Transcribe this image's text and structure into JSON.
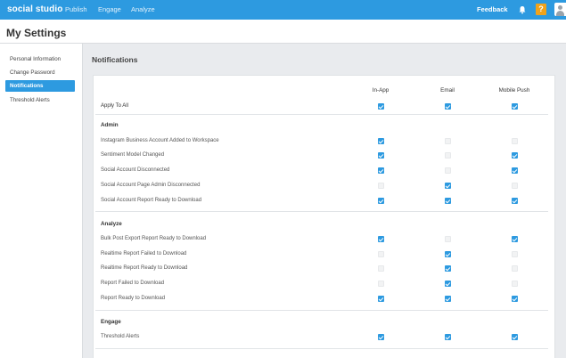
{
  "header": {
    "brand": "social studio",
    "nav": [
      "Publish",
      "Engage",
      "Analyze"
    ],
    "feedback": "Feedback",
    "help_label": "?",
    "icons": [
      "bell-icon",
      "help-icon",
      "avatar-icon"
    ],
    "accent_color": "#2d9ae0"
  },
  "page": {
    "title": "My Settings"
  },
  "sidebar": {
    "items": [
      {
        "label": "Personal Information",
        "active": false
      },
      {
        "label": "Change Password",
        "active": false
      },
      {
        "label": "Notifications",
        "active": true
      },
      {
        "label": "Threshold Alerts",
        "active": false
      }
    ]
  },
  "notifications": {
    "title": "Notifications",
    "columns": [
      "In-App",
      "Email",
      "Mobile Push"
    ],
    "apply_all": {
      "label": "Apply To All",
      "values": [
        true,
        true,
        true
      ]
    },
    "sections": [
      {
        "title": "Admin",
        "rows": [
          {
            "label": "Instagram Business Account Added to Workspace",
            "values": [
              true,
              false,
              false
            ]
          },
          {
            "label": "Sentiment Model Changed",
            "values": [
              true,
              false,
              true
            ]
          },
          {
            "label": "Social Account Disconnected",
            "values": [
              true,
              false,
              true
            ]
          },
          {
            "label": "Social Account Page Admin Disconnected",
            "values": [
              false,
              true,
              false
            ]
          },
          {
            "label": "Social Account Report Ready to Download",
            "values": [
              true,
              true,
              true
            ]
          }
        ]
      },
      {
        "title": "Analyze",
        "rows": [
          {
            "label": "Bulk Post Export Report Ready to Download",
            "values": [
              true,
              false,
              true
            ]
          },
          {
            "label": "Realtime Report Failed to Download",
            "values": [
              false,
              true,
              false
            ]
          },
          {
            "label": "Realtime Report Ready to Download",
            "values": [
              false,
              true,
              false
            ]
          },
          {
            "label": "Report Failed to Download",
            "values": [
              false,
              true,
              false
            ]
          },
          {
            "label": "Report Ready to Download",
            "values": [
              true,
              true,
              true
            ]
          }
        ]
      },
      {
        "title": "Engage",
        "rows": [
          {
            "label": "Threshold Alerts",
            "values": [
              true,
              true,
              true
            ]
          }
        ]
      }
    ]
  }
}
